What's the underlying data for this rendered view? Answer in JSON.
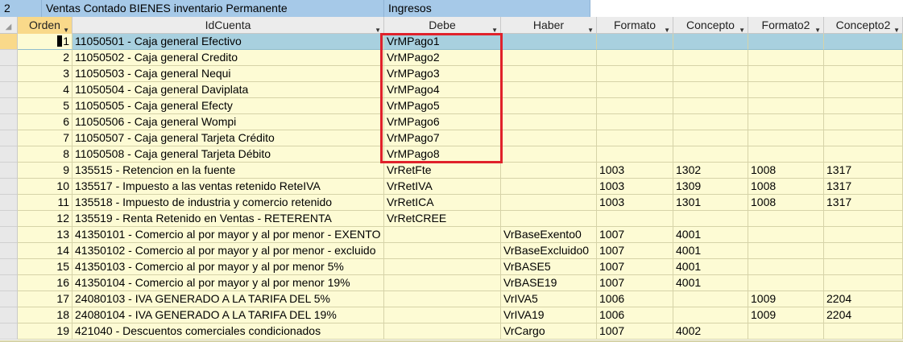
{
  "top": {
    "num": "2",
    "name": "Ventas Contado BIENES inventario Permanente",
    "type": "Ingresos"
  },
  "headers": [
    "Orden",
    "IdCuenta",
    "Debe",
    "Haber",
    "Formato",
    "Concepto",
    "Formato2",
    "Concepto2"
  ],
  "rows": [
    [
      "1",
      "11050501 - Caja general Efectivo",
      "VrMPago1",
      "",
      "",
      "",
      "",
      ""
    ],
    [
      "2",
      "11050502 - Caja general Credito",
      "VrMPago2",
      "",
      "",
      "",
      "",
      ""
    ],
    [
      "3",
      "11050503 - Caja general Nequi",
      "VrMPago3",
      "",
      "",
      "",
      "",
      ""
    ],
    [
      "4",
      "11050504 - Caja general Daviplata",
      "VrMPago4",
      "",
      "",
      "",
      "",
      ""
    ],
    [
      "5",
      "11050505 - Caja general Efecty",
      "VrMPago5",
      "",
      "",
      "",
      "",
      ""
    ],
    [
      "6",
      "11050506 - Caja general Wompi",
      "VrMPago6",
      "",
      "",
      "",
      "",
      ""
    ],
    [
      "7",
      "11050507 - Caja general Tarjeta Crédito",
      "VrMPago7",
      "",
      "",
      "",
      "",
      ""
    ],
    [
      "8",
      "11050508 - Caja general Tarjeta Débito",
      "VrMPago8",
      "",
      "",
      "",
      "",
      ""
    ],
    [
      "9",
      "135515 - Retencion en la fuente",
      "VrRetFte",
      "",
      "1003",
      "1302",
      "1008",
      "1317"
    ],
    [
      "10",
      "135517 - Impuesto a las ventas retenido ReteIVA",
      "VrRetIVA",
      "",
      "1003",
      "1309",
      "1008",
      "1317"
    ],
    [
      "11",
      "135518 - Impuesto de industria y comercio retenido",
      "VrRetICA",
      "",
      "1003",
      "1301",
      "1008",
      "1317"
    ],
    [
      "12",
      "135519 - Renta Retenido en Ventas - RETERENTA",
      "VrRetCREE",
      "",
      "",
      "",
      "",
      ""
    ],
    [
      "13",
      "41350101 - Comercio al por mayor y al por menor - EXENTO",
      "",
      "VrBaseExento0",
      "1007",
      "4001",
      "",
      ""
    ],
    [
      "14",
      "41350102 - Comercio al por mayor y al por menor - excluido",
      "",
      "VrBaseExcluido0",
      "1007",
      "4001",
      "",
      ""
    ],
    [
      "15",
      "41350103 - Comercio al por mayor y al por menor 5%",
      "",
      "VrBASE5",
      "1007",
      "4001",
      "",
      ""
    ],
    [
      "16",
      "41350104 - Comercio al por mayor y al por menor 19%",
      "",
      "VrBASE19",
      "1007",
      "4001",
      "",
      ""
    ],
    [
      "17",
      "24080103 - IVA GENERADO A LA TARIFA DEL 5%",
      "",
      "VrIVA5",
      "1006",
      "",
      "1009",
      "2204"
    ],
    [
      "18",
      "24080104 - IVA GENERADO A LA TARIFA DEL 19%",
      "",
      "VrIVA19",
      "1006",
      "",
      "1009",
      "2204"
    ],
    [
      "19",
      "421040 - Descuentos comerciales condicionados",
      "",
      "VrCargo",
      "1007",
      "4002",
      "",
      ""
    ]
  ]
}
